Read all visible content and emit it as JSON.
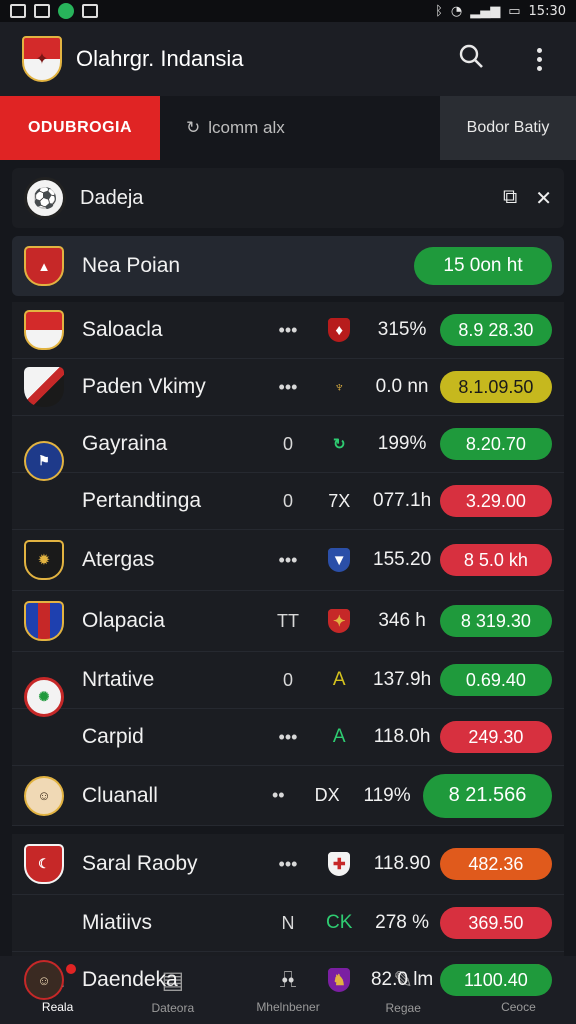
{
  "status_bar": {
    "time": "15:30"
  },
  "app": {
    "title": "Olahrgr. Indansia",
    "search_icon": "search-icon",
    "menu_icon": "more-vertical-icon"
  },
  "tabs": {
    "active": "ODUBROGIA",
    "middle": "lcomm alx",
    "right": "Bodor Batiy"
  },
  "league": {
    "name": "Dadeja"
  },
  "feature": {
    "name": "Nea Poian",
    "pill": "15 0on ht"
  },
  "rows": [
    {
      "team": "Saloacla",
      "c1": "•••",
      "c3": "315%",
      "pill": "8.9 28.30",
      "color": "#1f9a3c"
    },
    {
      "team": "Paden Vkimy",
      "c1": "•••",
      "c3": "0.0 nn",
      "pill": "8.1.09.50",
      "color": "#c6b81e"
    },
    {
      "team": "Gayraina",
      "c1": "0",
      "c3": "199%",
      "pill": "8.20.70",
      "color": "#1f9a3c"
    },
    {
      "team": "Pertandtinga",
      "c1": "0",
      "c2": "7X",
      "c3": "077.1h",
      "pill": "3.29.00",
      "color": "#d7303f"
    },
    {
      "team": "Atergas",
      "c1": "•••",
      "c3": "155.20",
      "pill": "8 5.0 kh",
      "color": "#d7303f"
    },
    {
      "team": "Olapacia",
      "c1": "TT",
      "c3": "346 h",
      "pill": "8 319.30",
      "color": "#1f9a3c"
    },
    {
      "team": "Nrtative",
      "c1": "0",
      "c2": "A",
      "c3": "137.9h",
      "pill": "0.69.40",
      "color": "#1f9a3c"
    },
    {
      "team": "Carpid",
      "c1": "•••",
      "c2": "A",
      "c3": "118.0h",
      "pill": "249.30",
      "color": "#d7303f"
    },
    {
      "team": "Cluanall",
      "c1": "••",
      "c2": "DX",
      "c3": "119%",
      "pill": "8 21.566",
      "color": "#1f9a3c"
    },
    {
      "team": "Saral Raoby",
      "c1": "•••",
      "c3": "118.90",
      "pill": "482.36",
      "color": "#e05a1c"
    },
    {
      "team": "Miatiivs",
      "c1": "N",
      "c2": "CK",
      "c3": "278 %",
      "pill": "369.50",
      "color": "#d7303f"
    },
    {
      "team": "Daendeka",
      "c1": "••",
      "c3": "82.0 lm",
      "pill": "1100.40",
      "color": "#1f9a3c"
    }
  ],
  "nav": [
    {
      "label": "Reala",
      "icon": "home-icon"
    },
    {
      "label": "Dateora",
      "icon": "calendar-icon"
    },
    {
      "label": "Mhelnbener",
      "icon": "stats-icon"
    },
    {
      "label": "Regae",
      "icon": "edit-icon"
    },
    {
      "label": "Ceoce",
      "icon": "search-icon"
    }
  ]
}
